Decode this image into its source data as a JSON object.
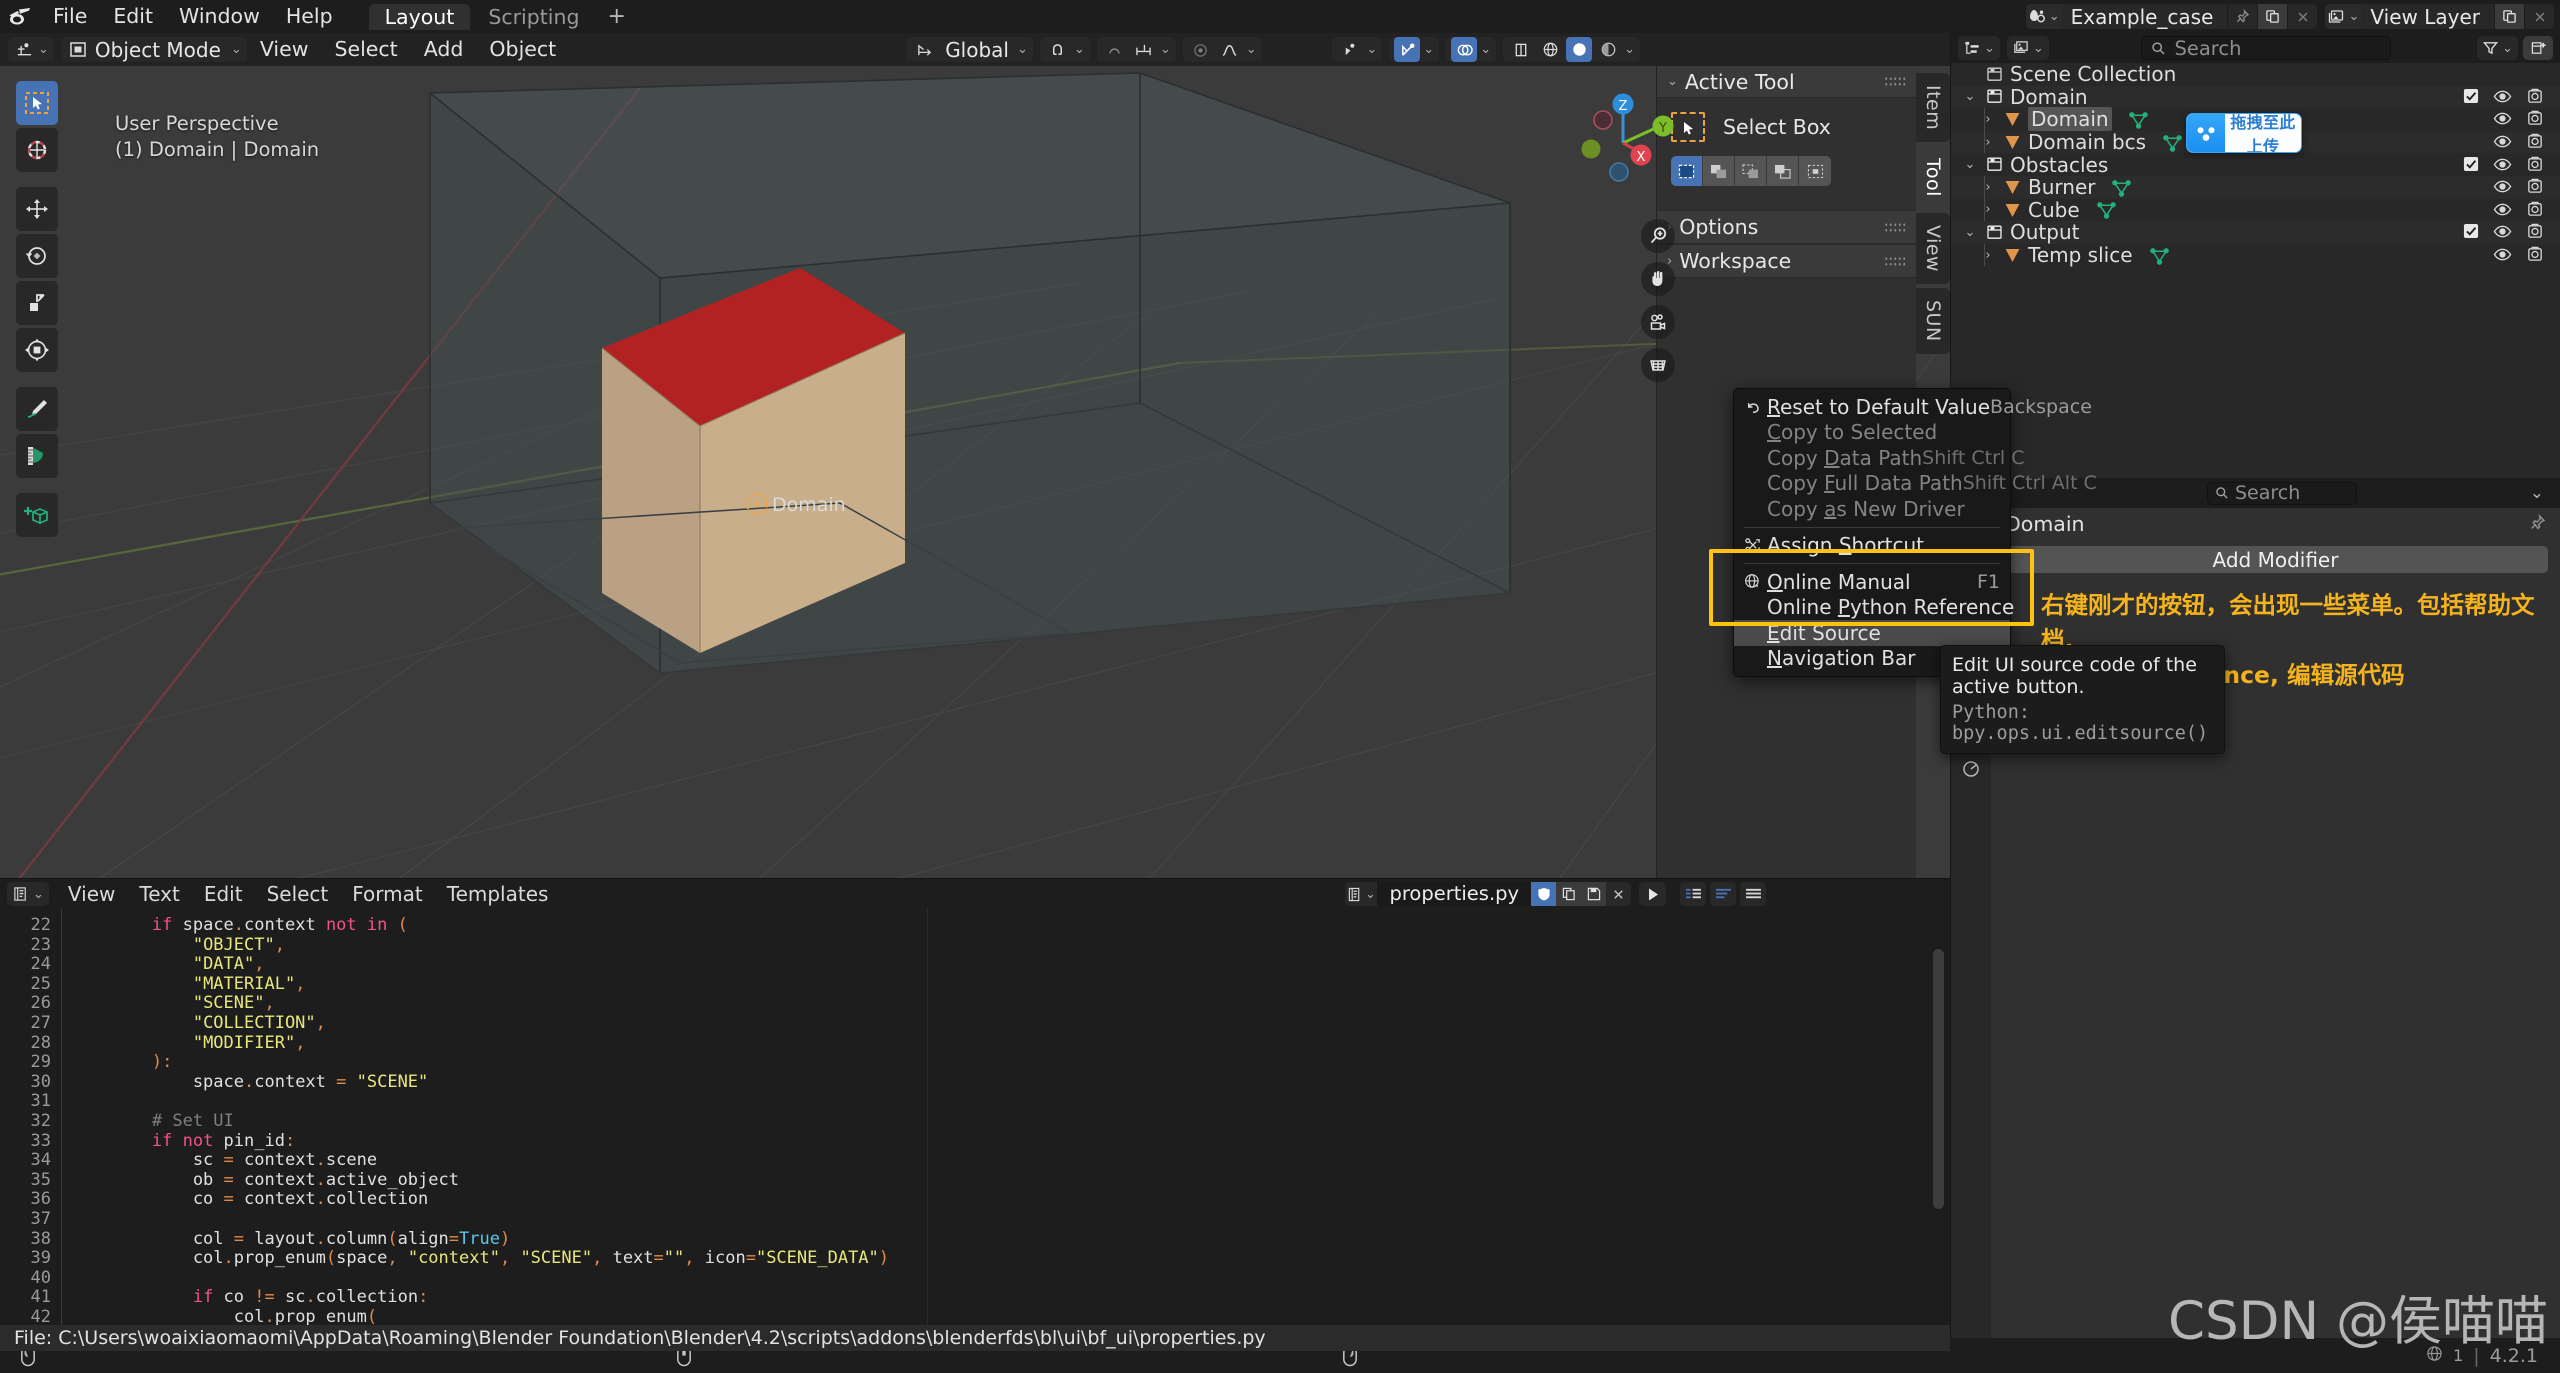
{
  "colors": {
    "accent_blue": "#4772b3",
    "highlight_yellow": "#ffc20e",
    "note_orange": "#f5b41c",
    "viewport_bg": "#3b3b3b",
    "cube_top_red": "#b22222",
    "cube_side_tan": "#c9ae8b",
    "mesh_green": "#24b07a",
    "obj_orange": "#e08a4b"
  },
  "topbar": {
    "logo": "blender-logo-icon",
    "menus": [
      "File",
      "Edit",
      "Window",
      "Help"
    ],
    "workspaces": [
      {
        "label": "Layout",
        "active": true
      },
      {
        "label": "Scripting",
        "active": false
      }
    ],
    "add_workspace": "+",
    "scene": {
      "icon": "scene-icon",
      "name": "Example_case",
      "pin": "pin-icon",
      "copy": "duplicate-icon",
      "close": "x-icon"
    },
    "viewlayer": {
      "icon": "viewlayer-icon",
      "name": "View Layer",
      "copy": "duplicate-icon",
      "close": "x-icon"
    }
  },
  "viewport": {
    "header": {
      "editor_type_icon": "editor-type-3dview-icon",
      "mode_icon": "object-mode-icon",
      "mode": "Object Mode",
      "menus": [
        "View",
        "Select",
        "Add",
        "Object"
      ],
      "transform_orientation": "Global",
      "orientation_icon": "orientation-icon",
      "snap_icon": "snap-magnet-icon",
      "snap_to_icon": "snap-increment-icon",
      "pivot_icon": "pivot-point-icon",
      "proportional_icon": "proportional-edit-icon",
      "right_icons": [
        {
          "name": "visibility-selector-icon",
          "active": false
        },
        {
          "name": "show-gizmo-icon",
          "active": true
        },
        {
          "name": "show-overlays-icon",
          "active": true
        },
        {
          "name": "xray-toggle-icon",
          "active": false
        },
        {
          "name": "shading-wireframe-icon",
          "active": false
        },
        {
          "name": "shading-solid-icon",
          "active": true
        },
        {
          "name": "shading-material-icon",
          "active": false
        }
      ]
    },
    "overlay_text_line1": "User Perspective",
    "overlay_text_line2": "(1) Domain | Domain",
    "object_origin_label": "Domain",
    "gizmo_axes": [
      "Z",
      "Y",
      "X"
    ],
    "nav_buttons": [
      "zoom-icon",
      "pan-hand-icon",
      "camera-view-icon",
      "ortho-persp-toggle-icon"
    ],
    "toolbar": [
      {
        "name": "tweak-select-box-tool",
        "active": true
      },
      {
        "name": "cursor-tool",
        "active": false
      },
      {
        "name": "move-tool",
        "active": false
      },
      {
        "name": "rotate-tool",
        "active": false
      },
      {
        "name": "scale-tool",
        "active": false
      },
      {
        "name": "transform-tool",
        "active": false
      },
      {
        "name": "annotate-tool",
        "active": false
      },
      {
        "name": "measure-tool",
        "active": false
      },
      {
        "name": "add-cube-tool",
        "active": false
      }
    ],
    "npanel": {
      "sections": [
        {
          "label": "Active Tool",
          "open": true
        },
        {
          "label": "Options",
          "open": false
        },
        {
          "label": "Workspace",
          "open": false
        }
      ],
      "active_tool_name": "Select Box",
      "active_tool_icon": "select-box-icon",
      "select_modes": [
        {
          "name": "select-set-mode",
          "active": true
        },
        {
          "name": "select-extend-mode",
          "active": false
        },
        {
          "name": "select-subtract-mode",
          "active": false
        },
        {
          "name": "select-difference-mode",
          "active": false
        },
        {
          "name": "select-intersect-mode",
          "active": false
        }
      ],
      "tabs": [
        {
          "label": "Item",
          "active": false
        },
        {
          "label": "Tool",
          "active": true
        },
        {
          "label": "View",
          "active": false
        },
        {
          "label": "SUN",
          "active": false
        }
      ]
    }
  },
  "outliner": {
    "header": {
      "editor_type_icon": "editor-type-outliner-icon",
      "display_mode_icon": "outliner-view-layer-icon",
      "search_placeholder": "Search",
      "filter_icon": "filter-funnel-icon",
      "new_collection_icon": "new-collection-icon"
    },
    "rows": [
      {
        "label": "Scene Collection",
        "icon": "collection-icon",
        "indent": 0,
        "twisty": "",
        "checkbox": false,
        "eye": false,
        "camera": false,
        "mesh": false
      },
      {
        "label": "Domain",
        "icon": "collection-icon",
        "indent": 0,
        "twisty": "open",
        "checkbox": true,
        "eye": true,
        "camera": true,
        "mesh": false
      },
      {
        "label": "Domain",
        "icon": "mesh-object-icon",
        "indent": 1,
        "twisty": "closed",
        "checkbox": false,
        "eye": true,
        "camera": true,
        "mesh": true,
        "selected": true
      },
      {
        "label": "Domain bcs",
        "icon": "mesh-object-icon",
        "indent": 1,
        "twisty": "closed",
        "checkbox": false,
        "eye": true,
        "camera": true,
        "mesh": true
      },
      {
        "label": "Obstacles",
        "icon": "collection-icon",
        "indent": 0,
        "twisty": "open",
        "checkbox": true,
        "eye": true,
        "camera": true,
        "mesh": false
      },
      {
        "label": "Burner",
        "icon": "mesh-object-icon",
        "indent": 1,
        "twisty": "closed",
        "checkbox": false,
        "eye": true,
        "camera": true,
        "mesh": true
      },
      {
        "label": "Cube",
        "icon": "mesh-object-icon",
        "indent": 1,
        "twisty": "closed",
        "checkbox": false,
        "eye": true,
        "camera": true,
        "mesh": true
      },
      {
        "label": "Output",
        "icon": "collection-icon",
        "indent": 0,
        "twisty": "open",
        "checkbox": true,
        "eye": true,
        "camera": true,
        "mesh": false
      },
      {
        "label": "Temp slice",
        "icon": "mesh-object-icon",
        "indent": 1,
        "twisty": "closed",
        "checkbox": false,
        "eye": true,
        "camera": true,
        "mesh": true
      }
    ]
  },
  "baidu_toast": {
    "icon": "baidu-netdisk-icon",
    "text": "拖拽至此上传"
  },
  "properties": {
    "search_placeholder": "Search",
    "expand_icon": "chevron-down-icon",
    "breadcrumb": "Domain",
    "pin_icon": "pin-icon",
    "add_modifier_label": "Add Modifier",
    "annotation_line1": "右键刚才的按钮，会出现一些菜单。包括帮助文档,",
    "annotation_line2": "python reference, 编辑源代码"
  },
  "context_menu": {
    "items": [
      {
        "label": "Reset to Default Value",
        "underline": "R",
        "shortcut": "Backspace",
        "icon": "undo-arrow-icon",
        "disabled": false,
        "highlighted": false
      },
      {
        "label": "Copy to Selected",
        "underline": "C",
        "shortcut": "",
        "icon": "",
        "disabled": true,
        "highlighted": false
      },
      {
        "label": "Copy Data Path",
        "underline": "D",
        "shortcut": "Shift Ctrl C",
        "icon": "",
        "disabled": true,
        "highlighted": false
      },
      {
        "label": "Copy Full Data Path",
        "underline": "F",
        "shortcut": "Shift Ctrl Alt C",
        "icon": "",
        "disabled": true,
        "highlighted": false
      },
      {
        "label": "Copy as New Driver",
        "underline": "a",
        "shortcut": "",
        "icon": "",
        "disabled": true,
        "highlighted": false
      },
      {
        "separator": true
      },
      {
        "label": "Assign Shortcut",
        "underline": "S",
        "shortcut": "",
        "icon": "keyboard-shortcut-icon",
        "disabled": false,
        "highlighted": false
      },
      {
        "separator": true
      },
      {
        "label": "Online Manual",
        "underline": "O",
        "shortcut": "F1",
        "icon": "globe-link-icon",
        "disabled": false,
        "highlighted": false
      },
      {
        "label": "Online Python Reference",
        "underline": "P",
        "shortcut": "",
        "icon": "",
        "disabled": false,
        "highlighted": false
      },
      {
        "label": "Edit Source",
        "underline": "E",
        "shortcut": "",
        "icon": "",
        "disabled": false,
        "highlighted": true
      },
      {
        "label": "Navigation Bar",
        "underline": "N",
        "shortcut": "",
        "icon": "",
        "disabled": false,
        "submenu": true,
        "highlighted": false
      }
    ]
  },
  "tooltip": {
    "description": "Edit UI source code of the active button.",
    "python": "Python: bpy.ops.ui.editsource()"
  },
  "text_editor": {
    "header": {
      "editor_type_icon": "editor-type-text-icon",
      "menus": [
        "View",
        "Text",
        "Edit",
        "Select",
        "Format",
        "Templates"
      ],
      "datablock_icon": "text-datablock-icon",
      "filename": "properties.py",
      "register_icon": "register-check-icon",
      "duplicate_icon": "duplicate-icon",
      "save_icon": "save-icon",
      "close_icon": "x-icon",
      "run_script_icon": "run-script-play-icon",
      "view_icons": [
        "line-numbers-icon",
        "word-wrap-icon",
        "syntax-highlight-icon"
      ]
    },
    "first_line_number": 22,
    "lines": [
      {
        "n": 22,
        "tokens": [
          [
            "w",
            "        "
          ],
          [
            "k",
            "if "
          ],
          [
            "w",
            "space"
          ],
          [
            "p",
            "."
          ],
          [
            "w",
            "context "
          ],
          [
            "k",
            "not in"
          ],
          [
            "w",
            " "
          ],
          [
            "p",
            "("
          ]
        ]
      },
      {
        "n": 23,
        "tokens": [
          [
            "w",
            "            "
          ],
          [
            "s",
            "\"OBJECT\""
          ],
          [
            "p",
            ","
          ]
        ]
      },
      {
        "n": 24,
        "tokens": [
          [
            "w",
            "            "
          ],
          [
            "s",
            "\"DATA\""
          ],
          [
            "p",
            ","
          ]
        ]
      },
      {
        "n": 25,
        "tokens": [
          [
            "w",
            "            "
          ],
          [
            "s",
            "\"MATERIAL\""
          ],
          [
            "p",
            ","
          ]
        ]
      },
      {
        "n": 26,
        "tokens": [
          [
            "w",
            "            "
          ],
          [
            "s",
            "\"SCENE\""
          ],
          [
            "p",
            ","
          ]
        ]
      },
      {
        "n": 27,
        "tokens": [
          [
            "w",
            "            "
          ],
          [
            "s",
            "\"COLLECTION\""
          ],
          [
            "p",
            ","
          ]
        ]
      },
      {
        "n": 28,
        "tokens": [
          [
            "w",
            "            "
          ],
          [
            "s",
            "\"MODIFIER\""
          ],
          [
            "p",
            ","
          ]
        ]
      },
      {
        "n": 29,
        "tokens": [
          [
            "w",
            "        "
          ],
          [
            "p",
            "):"
          ]
        ]
      },
      {
        "n": 30,
        "tokens": [
          [
            "w",
            "            space"
          ],
          [
            "p",
            "."
          ],
          [
            "w",
            "context "
          ],
          [
            "p",
            "= "
          ],
          [
            "s",
            "\"SCENE\""
          ]
        ]
      },
      {
        "n": 31,
        "tokens": [
          [
            "w",
            ""
          ]
        ]
      },
      {
        "n": 32,
        "tokens": [
          [
            "w",
            "        "
          ],
          [
            "c",
            "# Set UI"
          ]
        ]
      },
      {
        "n": 33,
        "tokens": [
          [
            "w",
            "        "
          ],
          [
            "k",
            "if not "
          ],
          [
            "w",
            "pin_id"
          ],
          [
            "p",
            ":"
          ]
        ]
      },
      {
        "n": 34,
        "tokens": [
          [
            "w",
            "            sc "
          ],
          [
            "p",
            "= "
          ],
          [
            "w",
            "context"
          ],
          [
            "p",
            "."
          ],
          [
            "w",
            "scene"
          ]
        ]
      },
      {
        "n": 35,
        "tokens": [
          [
            "w",
            "            ob "
          ],
          [
            "p",
            "= "
          ],
          [
            "w",
            "context"
          ],
          [
            "p",
            "."
          ],
          [
            "w",
            "active_object"
          ]
        ]
      },
      {
        "n": 36,
        "tokens": [
          [
            "w",
            "            co "
          ],
          [
            "p",
            "= "
          ],
          [
            "w",
            "context"
          ],
          [
            "p",
            "."
          ],
          [
            "w",
            "collection"
          ]
        ]
      },
      {
        "n": 37,
        "tokens": [
          [
            "w",
            ""
          ]
        ]
      },
      {
        "n": 38,
        "tokens": [
          [
            "w",
            "            col "
          ],
          [
            "p",
            "= "
          ],
          [
            "w",
            "layout"
          ],
          [
            "p",
            "."
          ],
          [
            "w",
            "column"
          ],
          [
            "p",
            "("
          ],
          [
            "w",
            "align"
          ],
          [
            "p",
            "="
          ],
          [
            "b",
            "True"
          ],
          [
            "p",
            ")"
          ]
        ]
      },
      {
        "n": 39,
        "tokens": [
          [
            "w",
            "            col"
          ],
          [
            "p",
            "."
          ],
          [
            "w",
            "prop_enum"
          ],
          [
            "p",
            "("
          ],
          [
            "w",
            "space"
          ],
          [
            "p",
            ", "
          ],
          [
            "s",
            "\"context\""
          ],
          [
            "p",
            ", "
          ],
          [
            "s",
            "\"SCENE\""
          ],
          [
            "p",
            ", "
          ],
          [
            "w",
            "text"
          ],
          [
            "p",
            "="
          ],
          [
            "s",
            "\"\""
          ],
          [
            "p",
            ", "
          ],
          [
            "w",
            "icon"
          ],
          [
            "p",
            "="
          ],
          [
            "s",
            "\"SCENE_DATA\""
          ],
          [
            "p",
            ")"
          ]
        ]
      },
      {
        "n": 40,
        "tokens": [
          [
            "w",
            ""
          ]
        ]
      },
      {
        "n": 41,
        "tokens": [
          [
            "w",
            "            "
          ],
          [
            "k",
            "if "
          ],
          [
            "w",
            "co "
          ],
          [
            "p",
            "!= "
          ],
          [
            "w",
            "sc"
          ],
          [
            "p",
            "."
          ],
          [
            "w",
            "collection"
          ],
          [
            "p",
            ":"
          ]
        ]
      },
      {
        "n": 42,
        "tokens": [
          [
            "w",
            "                col"
          ],
          [
            "p",
            "."
          ],
          [
            "w",
            "prop_enum"
          ],
          [
            "p",
            "("
          ]
        ]
      }
    ]
  },
  "file_info": "File: C:\\Users\\woaixiaomaomi\\AppData\\Roaming\\Blender Foundation\\Blender\\4.2\\scripts\\addons\\blenderfds\\bl\\ui\\bf_ui\\properties.py",
  "statusbar": {
    "mouse_hints": [
      "mouse-left-icon",
      "mouse-middle-icon",
      "mouse-right-icon"
    ],
    "scene_stats_icon": "globe-icon",
    "collection_count": "1",
    "version": "4.2.1"
  },
  "watermark": "CSDN @侯喵喵"
}
